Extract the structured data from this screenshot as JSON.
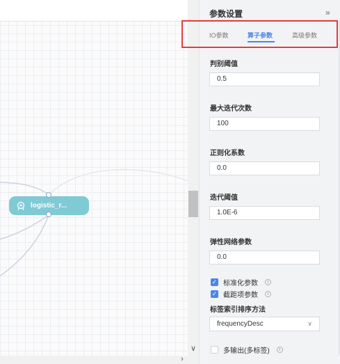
{
  "canvas": {
    "node_label": "logistic_r...",
    "node_icon": "model-icon"
  },
  "panel": {
    "title": "参数设置",
    "collapse_icon": "double-chevron-right-icon",
    "tabs": [
      {
        "label": "IO参数",
        "active": false
      },
      {
        "label": "算子参数",
        "active": true
      },
      {
        "label": "高级参数",
        "active": false
      }
    ],
    "fields": [
      {
        "label": "判别阈值",
        "value": "0.5"
      },
      {
        "label": "最大迭代次数",
        "value": "100"
      },
      {
        "label": "正则化系数",
        "value": "0.0"
      },
      {
        "label": "迭代阈值",
        "value": "1.0E-6"
      },
      {
        "label": "弹性网络参数",
        "value": "0.0"
      }
    ],
    "checkboxes": [
      {
        "label": "标准化参数",
        "checked": true
      },
      {
        "label": "截距项参数",
        "checked": true
      }
    ],
    "sort_label": "标签索引排序方法",
    "sort_value": "frequencyDesc",
    "multi_output_label": "多输出(多标签)",
    "info_glyph": "i"
  },
  "colors": {
    "accent": "#4a86e8",
    "node": "#7fcad5",
    "highlight": "#e43b3b"
  }
}
